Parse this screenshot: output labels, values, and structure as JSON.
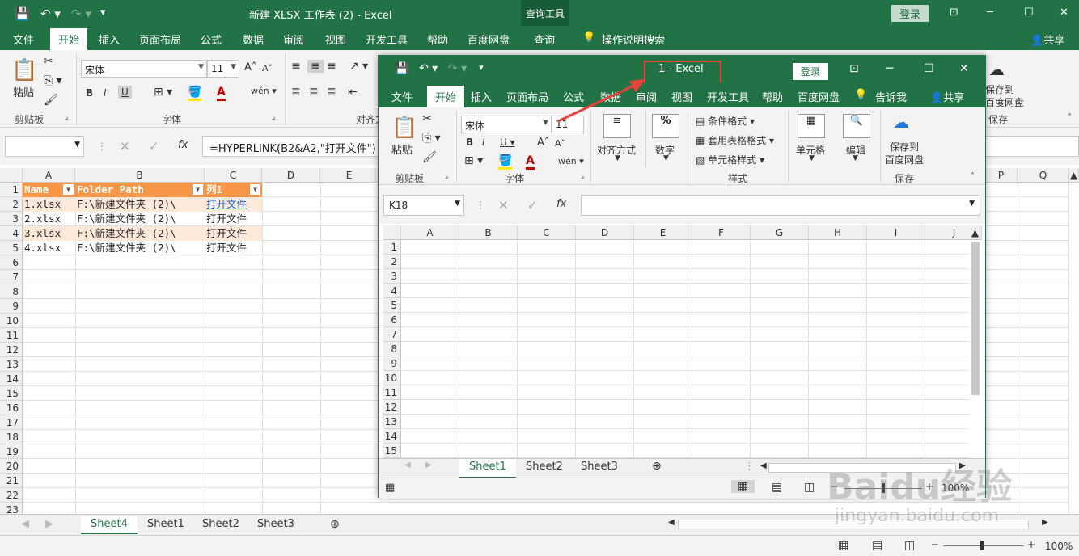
{
  "back": {
    "title": "新建 XLSX 工作表 (2)  -  Excel",
    "query_tools": "查询工具",
    "login": "登录",
    "tabs": [
      "文件",
      "开始",
      "插入",
      "页面布局",
      "公式",
      "数据",
      "审阅",
      "视图",
      "开发工具",
      "帮助",
      "百度网盘",
      "查询",
      "操作说明搜索"
    ],
    "share": "共享",
    "ribbon": {
      "paste": "粘贴",
      "clipboard": "剪贴板",
      "font_name": "宋体",
      "font_size": "11",
      "font_group": "字体",
      "align_group": "对齐方",
      "bold": "B",
      "italic": "I",
      "underline": "U",
      "save_to": "保存到",
      "baidu": "百度网盘",
      "save_group": "保存"
    },
    "formula": "=HYPERLINK(B2&A2,\"打开文件\")",
    "fx": "fx",
    "columns": [
      "A",
      "B",
      "C",
      "D",
      "E",
      "P",
      "Q"
    ],
    "rows": [
      "1",
      "2",
      "3",
      "4",
      "5",
      "6",
      "7",
      "8",
      "9",
      "10",
      "11",
      "12",
      "13",
      "14",
      "15",
      "16",
      "17",
      "18",
      "19",
      "20",
      "21",
      "22",
      "23"
    ],
    "table": {
      "headers": [
        "Name",
        "Folder Path",
        "列1"
      ],
      "rows": [
        [
          "1.xlsx",
          "F:\\新建文件夹 (2)\\",
          "打开文件"
        ],
        [
          "2.xlsx",
          "F:\\新建文件夹 (2)\\",
          "打开文件"
        ],
        [
          "3.xlsx",
          "F:\\新建文件夹 (2)\\",
          "打开文件"
        ],
        [
          "4.xlsx",
          "F:\\新建文件夹 (2)\\",
          "打开文件"
        ]
      ]
    },
    "sheets": [
      "Sheet4",
      "Sheet1",
      "Sheet2",
      "Sheet3"
    ],
    "zoom": "100%"
  },
  "front": {
    "title": "1  -  Excel",
    "login": "登录",
    "tabs": [
      "文件",
      "开始",
      "插入",
      "页面布局",
      "公式",
      "数据",
      "审阅",
      "视图",
      "开发工具",
      "帮助",
      "百度网盘",
      "告诉我"
    ],
    "share": "共享",
    "ribbon": {
      "paste": "粘贴",
      "clipboard": "剪贴板",
      "font_name": "宋体",
      "font_size": "11",
      "font_group": "字体",
      "align": "对齐方式",
      "number": "数字",
      "cond_format": "条件格式",
      "table_format": "套用表格格式",
      "cell_style": "单元格样式",
      "style_group": "样式",
      "cells": "单元格",
      "edit": "编辑",
      "save_to": "保存到",
      "baidu": "百度网盘",
      "save_group": "保存"
    },
    "namebox": "K18",
    "fx": "fx",
    "columns": [
      "A",
      "B",
      "C",
      "D",
      "E",
      "F",
      "G",
      "H",
      "I",
      "J"
    ],
    "rows": [
      "1",
      "2",
      "3",
      "4",
      "5",
      "6",
      "7",
      "8",
      "9",
      "10",
      "11",
      "12",
      "13",
      "14",
      "15"
    ],
    "sheets": [
      "Sheet1",
      "Sheet2",
      "Sheet3"
    ],
    "zoom": "100%"
  },
  "watermark": {
    "logo": "Baidu经验",
    "url": "jingyan.baidu.com"
  },
  "colors": {
    "excel_green": "#217346",
    "table_header": "#f79646",
    "table_band": "#fde9d9",
    "highlight": "#e8413a"
  }
}
